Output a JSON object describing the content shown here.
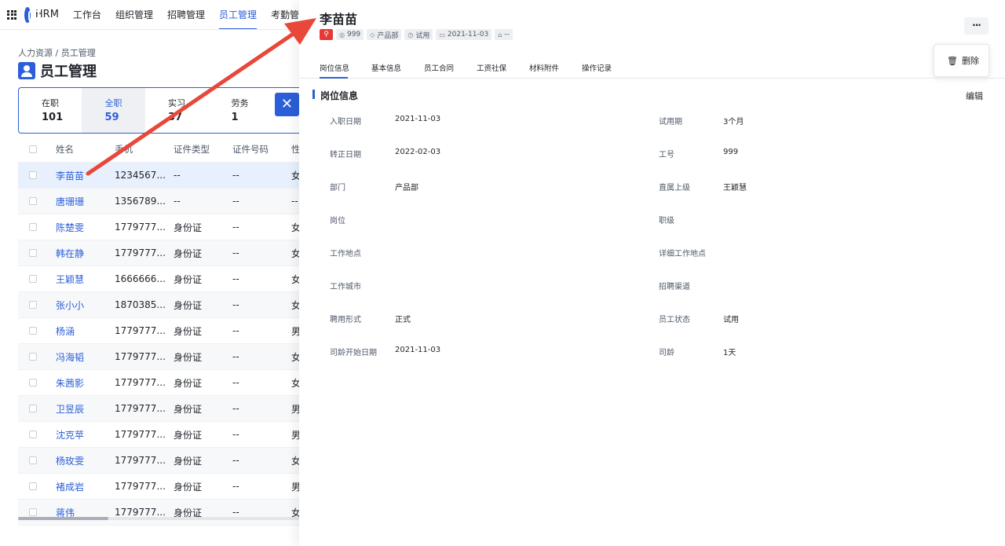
{
  "nav": {
    "brand": "HRM",
    "items": [
      "工作台",
      "组织管理",
      "招聘管理",
      "员工管理",
      "考勤管"
    ],
    "active_index": 3
  },
  "breadcrumb": "人力资源  /  员工管理",
  "page_title": "员工管理",
  "stats": [
    {
      "label": "在职",
      "value": "101"
    },
    {
      "label": "全职",
      "value": "59"
    },
    {
      "label": "实习",
      "value": "37"
    },
    {
      "label": "劳务",
      "value": "1"
    }
  ],
  "stats_active_index": 1,
  "close_icon_glyph": "✕",
  "table": {
    "headers": [
      "姓名",
      "手机",
      "证件类型",
      "证件号码",
      "性"
    ],
    "rows": [
      [
        "李苗苗",
        "1234567...",
        "--",
        "--",
        "女"
      ],
      [
        "唐珊珊",
        "1356789...",
        "--",
        "--",
        "--"
      ],
      [
        "陈楚雯",
        "1779777...",
        "身份证",
        "--",
        "女"
      ],
      [
        "韩在静",
        "1779777...",
        "身份证",
        "--",
        "女"
      ],
      [
        "王颖慧",
        "1666666...",
        "身份证",
        "--",
        "女"
      ],
      [
        "张小小",
        "1870385...",
        "身份证",
        "--",
        "女"
      ],
      [
        "杨涵",
        "1779777...",
        "身份证",
        "--",
        "男"
      ],
      [
        "冯海韬",
        "1779777...",
        "身份证",
        "--",
        "女"
      ],
      [
        "朱茜影",
        "1779777...",
        "身份证",
        "--",
        "女"
      ],
      [
        "卫昱辰",
        "1779777...",
        "身份证",
        "--",
        "男"
      ],
      [
        "沈克苹",
        "1779777...",
        "身份证",
        "--",
        "男"
      ],
      [
        "杨玫雯",
        "1779777...",
        "身份证",
        "--",
        "女"
      ],
      [
        "褚成岩",
        "1779777...",
        "身份证",
        "--",
        "男"
      ],
      [
        "蒋伟",
        "1779777...",
        "身份证",
        "--",
        "女"
      ]
    ],
    "selected_index": 0,
    "scroll_position": 0
  },
  "drawer": {
    "name": "李苗苗",
    "tags": [
      {
        "icon": "camera-icon",
        "glyph": "◎",
        "text": "999"
      },
      {
        "icon": "layers-icon",
        "glyph": "◇",
        "text": "产品部"
      },
      {
        "icon": "clock-icon",
        "glyph": "◷",
        "text": "试用"
      },
      {
        "icon": "card-icon",
        "glyph": "▭",
        "text": "2021-11-03"
      },
      {
        "icon": "briefcase-icon",
        "glyph": "⌂",
        "text": "--"
      }
    ],
    "red_tag_icon": "search-icon",
    "more_label": "···",
    "menu_delete": "删除",
    "tabs": [
      "岗位信息",
      "基本信息",
      "员工合同",
      "工资社保",
      "材料附件",
      "操作记录"
    ],
    "active_tab": 0,
    "section_title": "岗位信息",
    "edit_label": "编辑",
    "fields": [
      [
        {
          "label": "入职日期",
          "value": "2021-11-03"
        },
        {
          "label": "试用期",
          "value": "3个月"
        }
      ],
      [
        {
          "label": "转正日期",
          "value": "2022-02-03"
        },
        {
          "label": "工号",
          "value": "999"
        }
      ],
      [
        {
          "label": "部门",
          "value": "产品部"
        },
        {
          "label": "直属上级",
          "value": "王颖慧"
        }
      ],
      [
        {
          "label": "岗位",
          "value": ""
        },
        {
          "label": "职级",
          "value": ""
        }
      ],
      [
        {
          "label": "工作地点",
          "value": ""
        },
        {
          "label": "详细工作地点",
          "value": ""
        }
      ],
      [
        {
          "label": "工作城市",
          "value": ""
        },
        {
          "label": "招聘渠道",
          "value": ""
        }
      ],
      [
        {
          "label": "聘用形式",
          "value": "正式"
        },
        {
          "label": "员工状态",
          "value": "试用"
        }
      ],
      [
        {
          "label": "司龄开始日期",
          "value": "2021-11-03"
        },
        {
          "label": "司龄",
          "value": "1天"
        }
      ]
    ]
  },
  "colors": {
    "accent": "#2b5fd9",
    "annotation_arrow": "#e8473a",
    "tag_red": "#e53935"
  }
}
